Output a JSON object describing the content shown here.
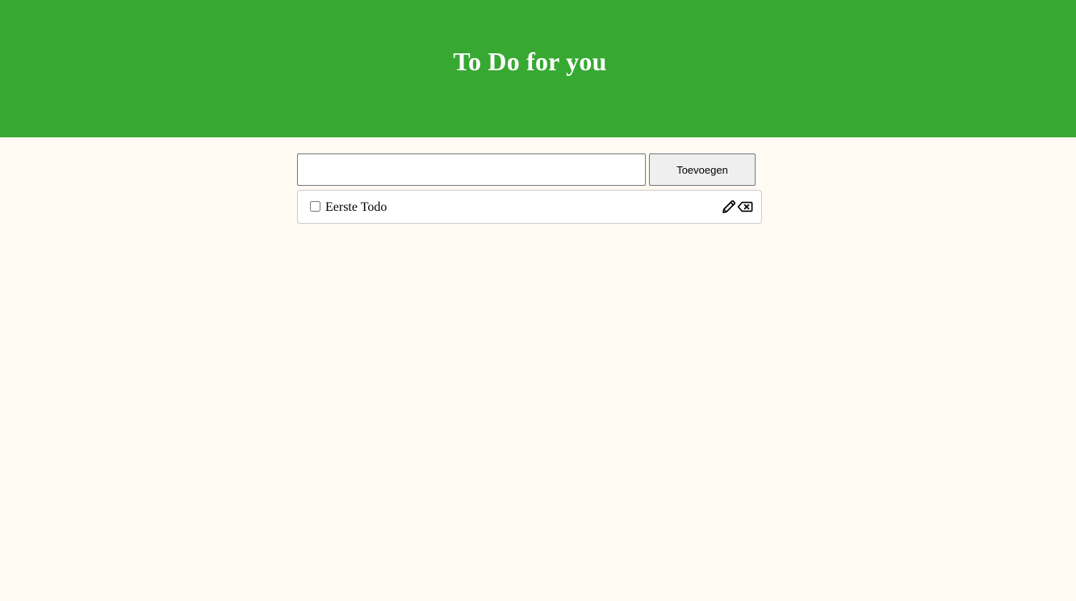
{
  "header": {
    "title": "To Do for you",
    "background_color": "#37a831"
  },
  "form": {
    "input_value": "",
    "input_placeholder": "",
    "add_button_label": "Toevoegen"
  },
  "todos": [
    {
      "text": "Eerste Todo",
      "checked": false,
      "icons": [
        "pencil-icon",
        "backspace-delete-icon"
      ]
    }
  ],
  "page": {
    "background_color": "#fffaf2"
  }
}
